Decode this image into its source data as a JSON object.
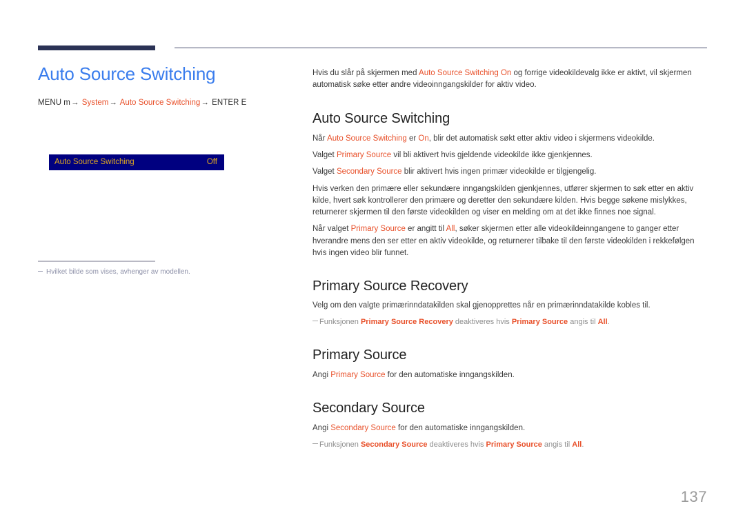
{
  "colors": {
    "accent_orange": "#e8502a",
    "title_blue": "#3a7ded",
    "rule_navy": "#2b3255",
    "osd_background": "#000080",
    "osd_text": "#e0a820",
    "note_gray": "#8d8d8d",
    "page_number_gray": "#9b9b9b"
  },
  "left": {
    "page_title": "Auto Source Switching",
    "menu_path": {
      "prefix": "MENU m",
      "arrow": "→",
      "step1": "System",
      "step2": "Auto Source Switching",
      "suffix": "ENTER E"
    },
    "osd": {
      "label": "Auto Source Switching",
      "value": "Off"
    },
    "note": "Hvilket bilde som vises, avhenger av modellen."
  },
  "right": {
    "intro": {
      "part1": "Hvis du slår på skjermen med ",
      "accent1": "Auto Source Switching On",
      "part2": " og forrige videokildevalg ikke er aktivt, vil skjermen automatisk søke etter andre videoinngangskilder for aktiv video."
    },
    "sections": [
      {
        "title": "Auto Source Switching",
        "paragraphs": [
          {
            "part1": "Når ",
            "accent1": "Auto Source Switching",
            "part2": " er ",
            "accent2": "On",
            "part3": ", blir det automatisk søkt etter aktiv video i skjermens videokilde."
          },
          {
            "part1": "Valget ",
            "accent1": "Primary Source",
            "part2": " vil bli aktivert hvis gjeldende videokilde ikke gjenkjennes."
          },
          {
            "part1": "Valget ",
            "accent1": "Secondary Source",
            "part2": " blir aktivert hvis ingen primær videokilde er tilgjengelig."
          },
          {
            "part1": "Hvis verken den primære eller sekundære inngangskilden gjenkjennes, utfører skjermen to søk etter en aktiv kilde, hvert søk kontrollerer den primære og deretter den sekundære kilden. Hvis begge søkene mislykkes, returnerer skjermen til den første videokilden og viser en melding om at det ikke finnes noe signal."
          },
          {
            "part1": "Når valget ",
            "accent1": "Primary Source",
            "part2": " er angitt til ",
            "accent2": "All",
            "part3": ", søker skjermen etter alle videokildeinngangene to ganger etter hverandre mens den ser etter en aktiv videokilde, og returnerer tilbake til den første videokilden i rekkefølgen hvis ingen video blir funnet."
          }
        ]
      },
      {
        "title": "Primary Source Recovery",
        "paragraph": "Velg om den valgte primærinndatakilden skal gjenopprettes når en primærinndatakilde kobles til.",
        "note": {
          "part1": "Funksjonen ",
          "accent1": "Primary Source Recovery",
          "part2": " deaktiveres hvis ",
          "accent2": "Primary Source",
          "part3": " angis til ",
          "accent3": "All",
          "part4": "."
        }
      },
      {
        "title": "Primary Source",
        "paragraph": {
          "part1": "Angi ",
          "accent1": "Primary Source",
          "part2": " for den automatiske inngangskilden."
        }
      },
      {
        "title": "Secondary Source",
        "paragraph": {
          "part1": "Angi ",
          "accent1": "Secondary Source",
          "part2": " for den automatiske inngangskilden."
        },
        "note": {
          "part1": "Funksjonen ",
          "accent1": "Secondary Source",
          "part2": " deaktiveres hvis ",
          "accent2": "Primary Source",
          "part3": " angis til ",
          "accent3": "All",
          "part4": "."
        }
      }
    ]
  },
  "footer": {
    "page_number": "137"
  }
}
